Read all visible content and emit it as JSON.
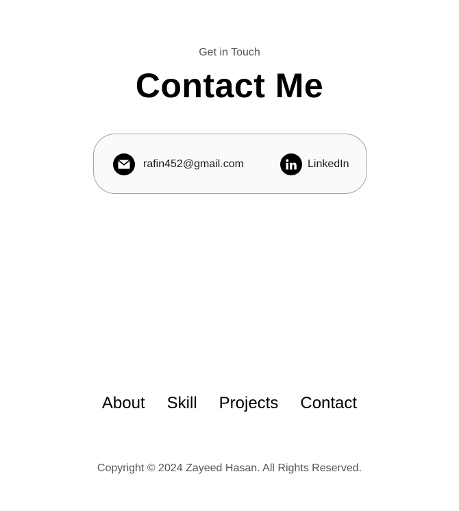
{
  "contact": {
    "subtitle": "Get in Touch",
    "title": "Contact Me",
    "email": {
      "icon": "mail-icon",
      "label": "rafin452@gmail.com"
    },
    "linkedin": {
      "icon": "linkedin-icon",
      "label": "LinkedIn"
    }
  },
  "footer": {
    "nav": [
      {
        "label": "About"
      },
      {
        "label": "Skill"
      },
      {
        "label": "Projects"
      },
      {
        "label": "Contact"
      }
    ],
    "copyright": "Copyright © 2024 Zayeed Hasan. All Rights Reserved."
  },
  "colors": {
    "text": "#000000",
    "muted": "#555555",
    "box_border": "#a3a3a3",
    "box_background": "#fafafa"
  }
}
